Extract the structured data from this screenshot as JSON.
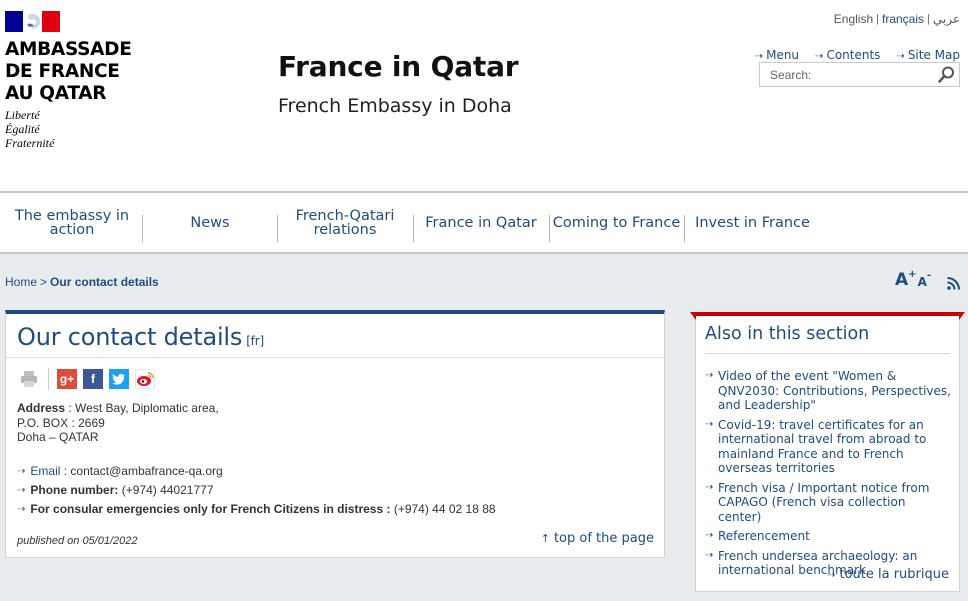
{
  "colors": {
    "brand_blue": "#1f4c80",
    "flag_blue": "#000091",
    "flag_red": "#e1000f",
    "aside_accent": "#cc0000"
  },
  "logo": {
    "name_line1": "AMBASSADE",
    "name_line2": "DE FRANCE",
    "name_line3": "AU QATAR",
    "motto1": "Liberté",
    "motto2": "Égalité",
    "motto3": "Fraternité"
  },
  "site": {
    "title": "France in Qatar",
    "subtitle": "French Embassy in Doha"
  },
  "languages": [
    {
      "label": "English"
    },
    {
      "label": "français"
    },
    {
      "label": "عربي"
    }
  ],
  "tools": {
    "menu": "Menu",
    "contents": "Contents",
    "sitemap": "Site Map"
  },
  "search": {
    "placeholder": "Search:",
    "icon": "search-icon"
  },
  "nav": [
    {
      "label": "The embassy in action"
    },
    {
      "label": "News"
    },
    {
      "label": "French-Qatari relations"
    },
    {
      "label": "France in Qatar"
    },
    {
      "label": "Coming to France"
    },
    {
      "label": "Invest in France"
    }
  ],
  "breadcrumb": {
    "home": "Home",
    "separator": ">",
    "current": "Our contact details"
  },
  "font_controls": {
    "increase": "A",
    "increase_sign": "+",
    "decrease": "A",
    "decrease_sign": "-"
  },
  "main": {
    "title": "Our contact details",
    "lang_tag": "[fr]",
    "share_icons": [
      "print-icon",
      "google-plus-icon",
      "facebook-icon",
      "twitter-icon",
      "weibo-icon"
    ],
    "address_label": "Address",
    "address_line1": "West Bay, Diplomatic area,",
    "address_line2": "P.O. BOX : 2669",
    "address_line3": "Doha – QATAR",
    "email_label": "Email",
    "email_value": "contact@ambafrance-qa.org",
    "phone_label": "Phone number:",
    "phone_value": "(+974) 44021777",
    "emergency_label": "For consular emergencies only for French Citizens in distress :",
    "emergency_value": "(+974) 44 02 18 88",
    "published": "published on 05/01/2022",
    "top_link": "top of the page"
  },
  "aside": {
    "title": "Also in this section",
    "items": [
      {
        "label": "Video of the event \"Women & QNV2030: Contributions, Perspectives, and Leadership\""
      },
      {
        "label": "Covid-19: travel certificates for an international travel from abroad to mainland France and to French overseas territories"
      },
      {
        "label": "French visa / Important notice from CAPAGO (French visa collection center)"
      },
      {
        "label": "Referencement"
      },
      {
        "label": "French undersea archaeology: an international benchmark"
      }
    ],
    "more": "toute la rubrique"
  }
}
